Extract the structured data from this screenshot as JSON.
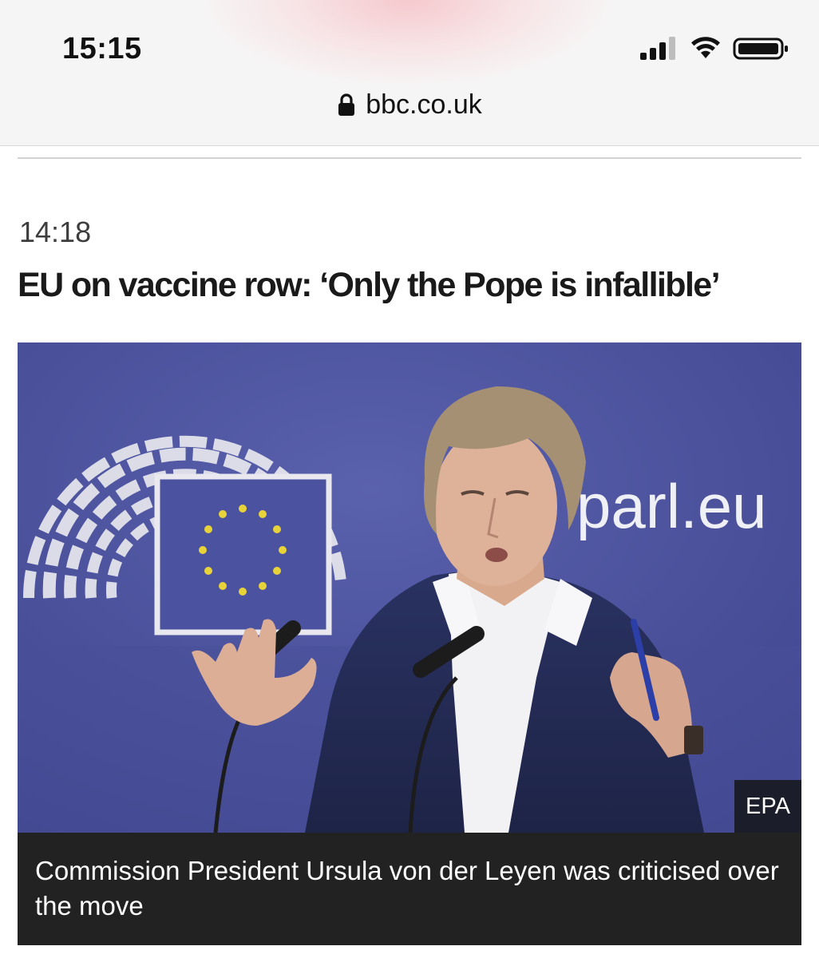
{
  "status_bar": {
    "time": "15:15",
    "signal_icon": "cellular-signal-icon",
    "wifi_icon": "wifi-icon",
    "battery_icon": "battery-icon"
  },
  "browser": {
    "url": "bbc.co.uk",
    "lock_icon": "lock-icon"
  },
  "article": {
    "timestamp": "14:18",
    "headline": "EU on vaccine row: ‘Only the Pope is infallible’",
    "image": {
      "backdrop_text": "parl.eu",
      "credit": "EPA",
      "caption": "Commission President Ursula von der Leyen was criticised over the move"
    }
  },
  "colors": {
    "backdrop_blue": "#4a4f9c",
    "caption_bg": "#222222",
    "text": "#1a1a1a"
  }
}
